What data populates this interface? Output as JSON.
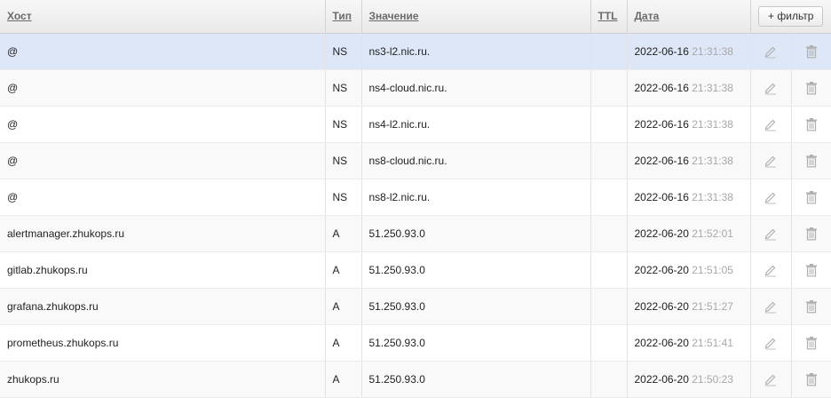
{
  "header": {
    "host": "Хост",
    "type": "Тип",
    "value": "Значение",
    "ttl": "TTL",
    "date": "Дата",
    "filter_button": "+ фильтр"
  },
  "rows": [
    {
      "host": "@",
      "type": "NS",
      "value": "ns3-l2.nic.ru.",
      "ttl": "",
      "date": "2022-06-16",
      "time": "21:31:38",
      "selected": true
    },
    {
      "host": "@",
      "type": "NS",
      "value": "ns4-cloud.nic.ru.",
      "ttl": "",
      "date": "2022-06-16",
      "time": "21:31:38"
    },
    {
      "host": "@",
      "type": "NS",
      "value": "ns4-l2.nic.ru.",
      "ttl": "",
      "date": "2022-06-16",
      "time": "21:31:38"
    },
    {
      "host": "@",
      "type": "NS",
      "value": "ns8-cloud.nic.ru.",
      "ttl": "",
      "date": "2022-06-16",
      "time": "21:31:38"
    },
    {
      "host": "@",
      "type": "NS",
      "value": "ns8-l2.nic.ru.",
      "ttl": "",
      "date": "2022-06-16",
      "time": "21:31:38"
    },
    {
      "host": "alertmanager.zhukops.ru",
      "type": "A",
      "value": "51.250.93.0",
      "ttl": "",
      "date": "2022-06-20",
      "time": "21:52:01"
    },
    {
      "host": "gitlab.zhukops.ru",
      "type": "A",
      "value": "51.250.93.0",
      "ttl": "",
      "date": "2022-06-20",
      "time": "21:51:05"
    },
    {
      "host": "grafana.zhukops.ru",
      "type": "A",
      "value": "51.250.93.0",
      "ttl": "",
      "date": "2022-06-20",
      "time": "21:51:27"
    },
    {
      "host": "prometheus.zhukops.ru",
      "type": "A",
      "value": "51.250.93.0",
      "ttl": "",
      "date": "2022-06-20",
      "time": "21:51:41"
    },
    {
      "host": "zhukops.ru",
      "type": "A",
      "value": "51.250.93.0",
      "ttl": "",
      "date": "2022-06-20",
      "time": "21:50:23"
    }
  ],
  "icons": {
    "edit": "pencil-icon",
    "delete": "trash-icon"
  },
  "colors": {
    "selected_row": "#dde7f7",
    "time_text": "#a8a8a8"
  }
}
